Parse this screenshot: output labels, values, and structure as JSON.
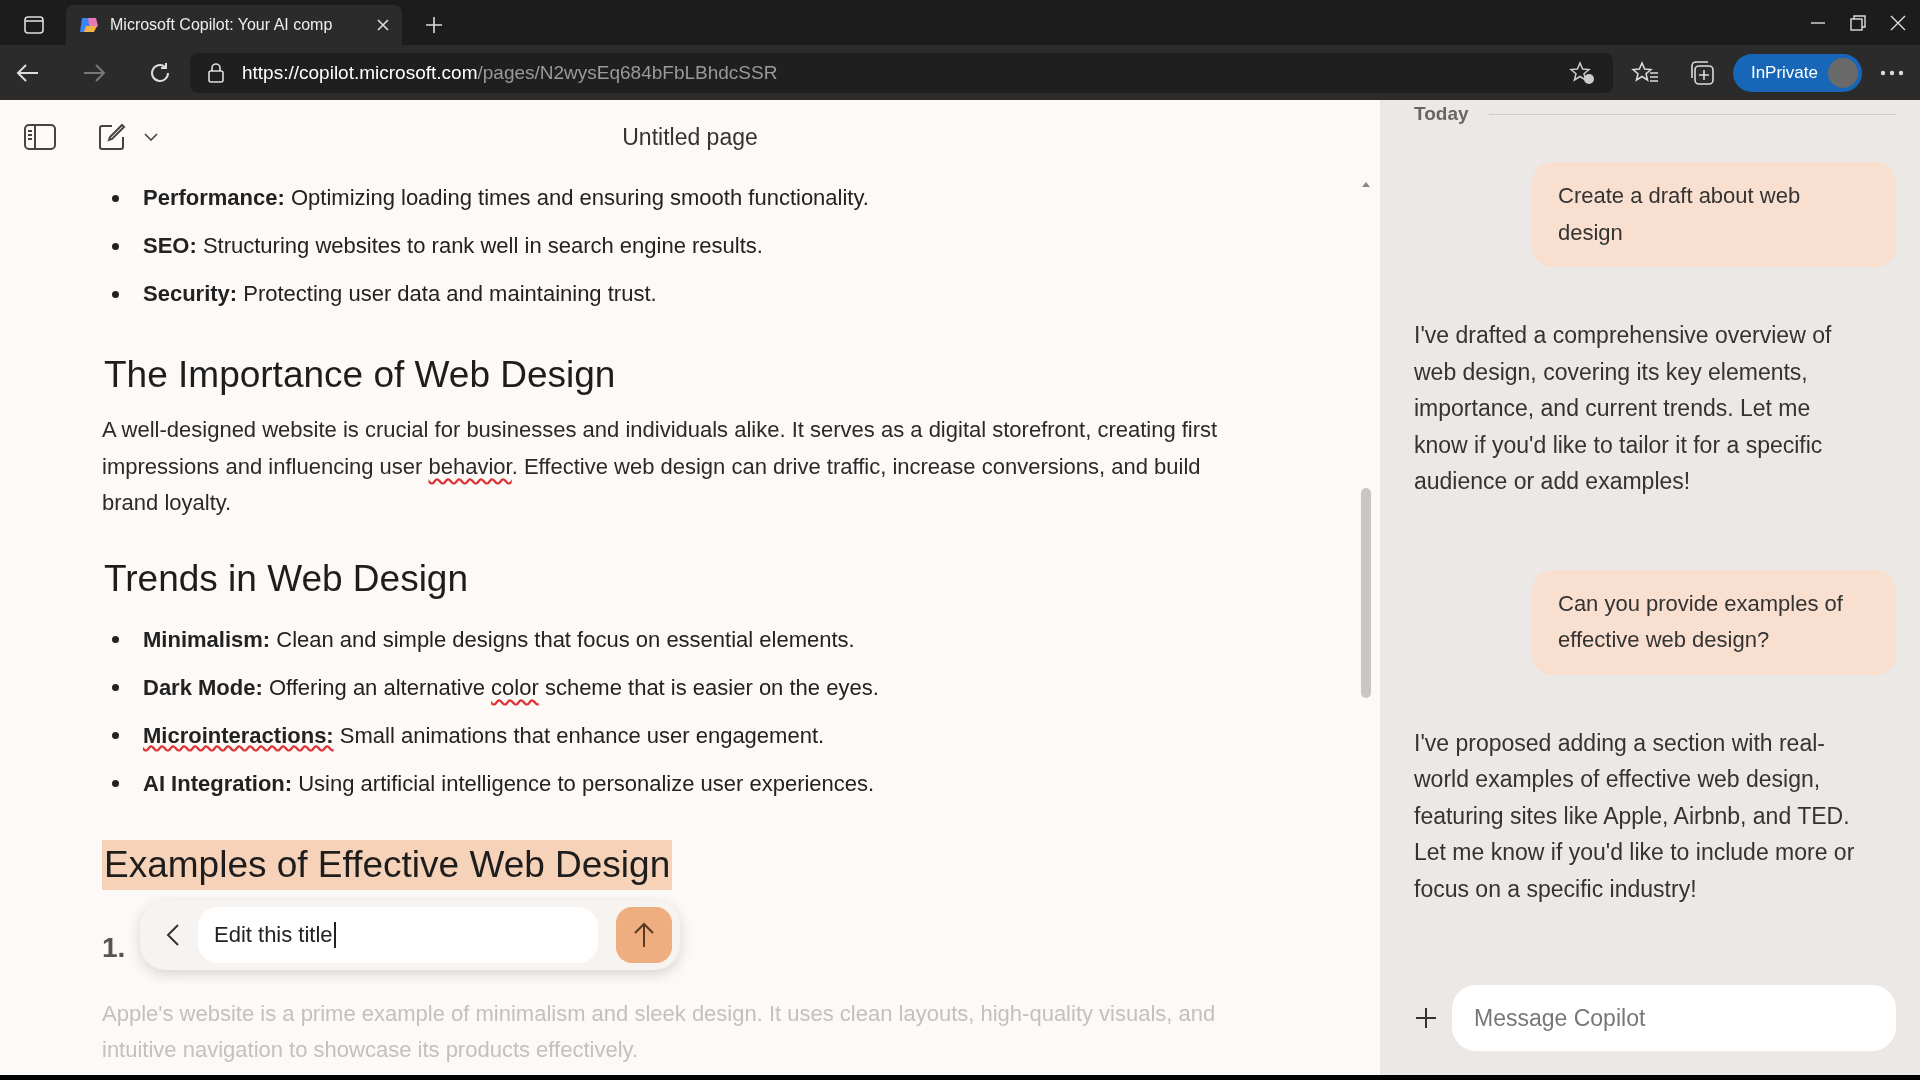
{
  "browser": {
    "tab_title": "Microsoft Copilot: Your AI comp",
    "url_host": "https://copilot.microsoft.com",
    "url_path": "/pages/N2wysEq684bFbLBhdcSSR",
    "profile_label": "InPrivate"
  },
  "document": {
    "title": "Untitled page",
    "blocks": [
      {
        "kind": "bullet",
        "term": "Performance:",
        "term_misspelled": false,
        "segments": [
          {
            "text": " Optimizing loading times and ensuring smooth functionality.",
            "misspelled": false
          }
        ]
      },
      {
        "kind": "bullet",
        "term": "SEO:",
        "term_misspelled": false,
        "segments": [
          {
            "text": " Structuring websites to rank well in search engine results.",
            "misspelled": false
          }
        ]
      },
      {
        "kind": "bullet",
        "term": "Security:",
        "term_misspelled": false,
        "segments": [
          {
            "text": " Protecting user data and maintaining trust.",
            "misspelled": false
          }
        ]
      },
      {
        "kind": "heading",
        "text": "The Importance of Web Design",
        "highlighted": false
      },
      {
        "kind": "paragraph",
        "segments": [
          {
            "text": "A well-designed website is crucial for businesses and individuals alike. It serves as a digital storefront, creating first impressions and influencing user ",
            "misspelled": false
          },
          {
            "text": "behavior",
            "misspelled": true
          },
          {
            "text": ". Effective web design can drive traffic, increase conversions, and build brand loyalty.",
            "misspelled": false
          }
        ]
      },
      {
        "kind": "heading",
        "text": "Trends in Web Design",
        "highlighted": false
      },
      {
        "kind": "bullet",
        "term": "Minimalism:",
        "term_misspelled": false,
        "segments": [
          {
            "text": " Clean and simple designs that focus on essential elements.",
            "misspelled": false
          }
        ]
      },
      {
        "kind": "bullet",
        "term": "Dark Mode:",
        "term_misspelled": false,
        "segments": [
          {
            "text": " Offering an alternative ",
            "misspelled": false
          },
          {
            "text": "color",
            "misspelled": true
          },
          {
            "text": " scheme that is easier on the eyes.",
            "misspelled": false
          }
        ]
      },
      {
        "kind": "bullet",
        "term": "Microinteractions:",
        "term_misspelled": true,
        "segments": [
          {
            "text": " Small animations that enhance user engagement.",
            "misspelled": false
          }
        ]
      },
      {
        "kind": "bullet",
        "term": "AI Integration:",
        "term_misspelled": false,
        "segments": [
          {
            "text": " Using artificial intelligence to personalize user experiences.",
            "misspelled": false
          }
        ]
      },
      {
        "kind": "heading",
        "text": "Examples of Effective Web Design",
        "highlighted": true
      },
      {
        "kind": "numbered",
        "text": "1."
      },
      {
        "kind": "faded",
        "text": "Apple's website is a prime example of minimalism and sleek design. It uses clean layouts, high-quality visuals, and intuitive navigation to showcase its products effectively."
      }
    ],
    "edit_popup": {
      "value": "Edit this title"
    }
  },
  "chat": {
    "day_label": "Today",
    "messages": [
      {
        "kind": "user",
        "text": "Create a draft about web design"
      },
      {
        "kind": "assistant",
        "text": "I've drafted a comprehensive overview of web design, covering its key elements, importance, and current trends. Let me know if you'd like to tailor it for a specific audience or add examples!"
      },
      {
        "kind": "user",
        "text": "Can you provide examples of effective web design?"
      },
      {
        "kind": "assistant",
        "text": "I've proposed adding a section with real-world examples of effective web design, featuring sites like Apple, Airbnb, and TED. Let me know if you'd like to include more or focus on a specific industry!"
      }
    ],
    "composer": {
      "placeholder": "Message Copilot"
    }
  }
}
